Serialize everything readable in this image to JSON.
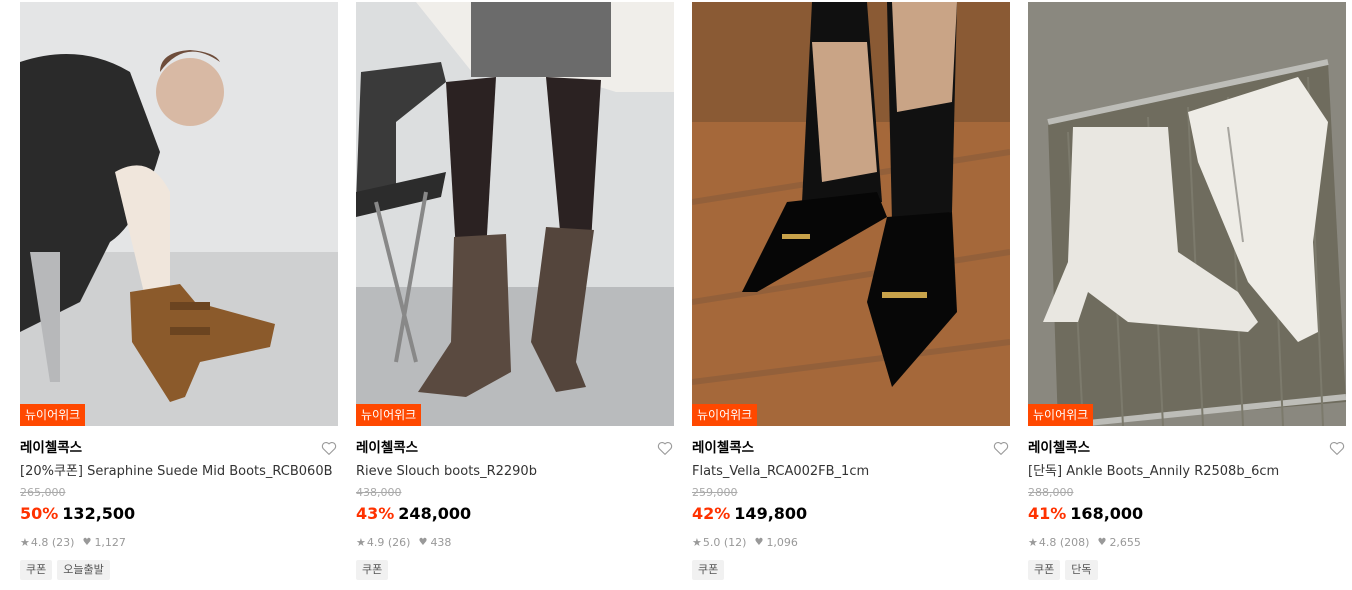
{
  "products": [
    {
      "badge": "뉴이어위크",
      "brand": "레이첼콕스",
      "name": "[20%쿠폰] Seraphine Suede Mid Boots_RCB060B",
      "original_price": "265,000",
      "discount": "50%",
      "price": "132,500",
      "rating": "4.8",
      "reviews": "(23)",
      "likes": "1,127",
      "tags": [
        "쿠폰",
        "오늘출발"
      ]
    },
    {
      "badge": "뉴이어위크",
      "brand": "레이첼콕스",
      "name": "Rieve Slouch boots_R2290b",
      "original_price": "438,000",
      "discount": "43%",
      "price": "248,000",
      "rating": "4.9",
      "reviews": "(26)",
      "likes": "438",
      "tags": [
        "쿠폰"
      ]
    },
    {
      "badge": "뉴이어위크",
      "brand": "레이첼콕스",
      "name": "Flats_Vella_RCA002FB_1cm",
      "original_price": "259,000",
      "discount": "42%",
      "price": "149,800",
      "rating": "5.0",
      "reviews": "(12)",
      "likes": "1,096",
      "tags": [
        "쿠폰"
      ]
    },
    {
      "badge": "뉴이어위크",
      "brand": "레이첼콕스",
      "name": "[단독] Ankle Boots_Annily R2508b_6cm",
      "original_price": "288,000",
      "discount": "41%",
      "price": "168,000",
      "rating": "4.8",
      "reviews": "(208)",
      "likes": "2,655",
      "tags": [
        "쿠폰",
        "단독"
      ]
    }
  ],
  "icons": {
    "wishlist": "heart-outline-icon",
    "rating": "star-icon",
    "likes": "heart-filled-icon"
  },
  "colors": {
    "badge": "#ff4800",
    "discount": "#ff3200"
  }
}
